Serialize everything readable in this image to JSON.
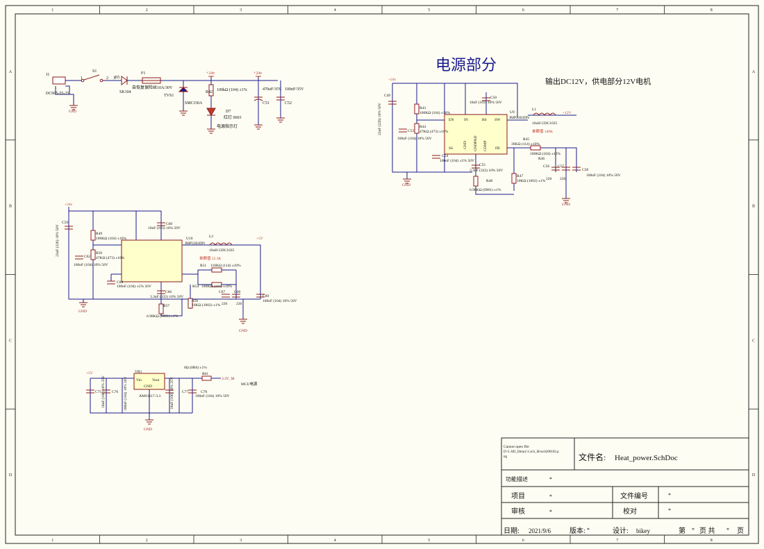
{
  "sheet": {
    "colors": {
      "bg": "#fdfdf3",
      "frame": "#222222",
      "wire": "#1a1a8c",
      "comp": "#8b1a1a",
      "power": "#c0392b",
      "gnd": "#8b1a1a",
      "ic_fill": "#ffffcc",
      "grid": "#e8e2c8"
    },
    "col_labels": [
      "1",
      "2",
      "3",
      "4",
      "5",
      "6",
      "7",
      "8"
    ],
    "row_labels": [
      "A",
      "B",
      "C",
      "D"
    ]
  },
  "texts": {
    "title_cn": "电源部分",
    "subtitle_cn": "输出DC12V，供电部分12V电机"
  },
  "input_section": {
    "j1": "J1",
    "j1_part": "DC005-55-25",
    "s1": "S1",
    "pin1": "1",
    "pin2": "2",
    "pin3": "3",
    "d5": "D5",
    "d5_part": "SK104",
    "f1": "F1",
    "f1_part": "自恢复保险丝10A/30V",
    "tvs_part": "SMCJ30A",
    "tvs_ref": "TVS1",
    "net_24v_a": "+24v",
    "net_24v_b": "+24v",
    "r42": "R42",
    "r42_val": "100kΩ (104) ±1%",
    "d7": "D7",
    "d7_val": "红灯 0603",
    "d7_note": "电源指示灯",
    "c51": "C51",
    "c51_val": "470uF/35V",
    "c52": "C52",
    "c52_val": "100nF/35V"
  },
  "buck12": {
    "net_24v": "+24v",
    "c49": "C49",
    "c49_val": "22uF (226) 10% 50V",
    "r43": "R43",
    "r43_val": "100KΩ (104) ±10%",
    "r44": "R44",
    "r44_val": "47KΩ (473) ±10%",
    "c53": "C53",
    "c53_val": "100nF (104) 10% 50V",
    "c54": "C54",
    "c54_val": "100nF (104) ±5% 50V",
    "c50": "C50",
    "c50_val": "10nF (103) 10% 50V",
    "u9": "U9",
    "u9_part": "JMP2303DN",
    "pin_en": "EN",
    "pin_in": "IN",
    "pin_bs": "BS",
    "pin_sw": "SW",
    "pin_ss": "SS",
    "pin_gnd": "GND",
    "pin_gndpad": "GNDPAD",
    "pin_comp": "COMP",
    "pin_fb": "FB",
    "l1": "L1",
    "l1_val": "10uH GDC1035",
    "net_12v": "+12V",
    "note_res": "单颗值 140K",
    "r45": "R45",
    "r45_val": "39KΩ (114) ±10%",
    "r46": "R46",
    "r46_val": "100KΩ (104) ±10%",
    "c55": "C55",
    "c55_val": "3.3nF (332) 10% 50V",
    "r48": "R48",
    "r48_val": "6.98KΩ (6981) ±1%",
    "r47": "R47",
    "r47_val": "10KΩ (1002) ±1%",
    "c56": "C56",
    "c56_val": "226",
    "c57": "C57",
    "c57_val": "226",
    "c58": "C58",
    "c58_val": "100nF (104) 10% 50V",
    "gnd1": "GND",
    "gnd2": "GND"
  },
  "buck5": {
    "net_24v": "+24v",
    "c59": "C59",
    "c59_val": "22uF (226) 10% 50V",
    "r49": "R49",
    "r49_val": "100KΩ (104) ±10%",
    "r50": "R50",
    "r50_val": "47KΩ (473) ±10%",
    "c62": "C62",
    "c62_val": "100nF (104) 10% 50V",
    "c64": "C64",
    "c64_val": "100nF (104) ±5% 50V",
    "c60": "C60",
    "c60_val": "10nF (103) 10% 50V",
    "u10": "U10",
    "u10_part": "JMP2303DN",
    "l2": "L2",
    "l2_val": "10uH GDC1035",
    "net_5v": "+5V",
    "note_res": "单颗值 52.3K",
    "r51": "R51",
    "r51_val": "110KΩ (114) ±10%",
    "r54": "R54",
    "r54_val": "100KΩ (104) ±10%",
    "c66": "C66",
    "c66_val": "3.3nF (332) 10% 50V",
    "r57": "R57",
    "r57_val": "6.98KΩ (6981) ±1%",
    "r56": "R56",
    "r56_val": "10KΩ (1002) ±1%",
    "c67": "C67",
    "c67_val": "226",
    "c68": "C68",
    "c68_val": "226",
    "c69": "C69",
    "c69_val": "100nF (104) 10% 50V",
    "gnd1": "GND",
    "gnd2": "GND"
  },
  "ldo": {
    "net_5v": "+5V",
    "c75": "C75",
    "c75_val": "10uF (106) 10% 25V",
    "c76": "C76",
    "c76_val": "100nF (104) 10% 50V",
    "vr1": "VR1",
    "vin": "Vin",
    "vout": "Vout",
    "gnd_pin": "GND",
    "part": "AMS1117-3.3",
    "c77": "C77",
    "c77_val": "10uF (106) 10% 25V",
    "c78": "C78",
    "c78_val": "100nF (104) 10% 50V",
    "r61": "R61",
    "r61_val": "0Ω (0R0) ±1%",
    "net_33": "3.3V_M",
    "mcu": "MCU电源",
    "gnd": "GND"
  },
  "title_block": {
    "cannot_open": "Cannot open file",
    "path_line1": "D:\\1.AD_library\\1.sch_lib\\sch200102.p",
    "path_line2": "ng",
    "file_name_label": "文件名:",
    "file_name": "Heat_power.SchDoc",
    "func_label": "功能描述",
    "func_val": "*",
    "project_label": "项目",
    "project_val": "*",
    "file_no_label": "文件编号",
    "file_no_val": "*",
    "review_label": "审核",
    "review_val": "*",
    "check_label": "校对",
    "check_val": "*",
    "date_label": "日期:",
    "date_val": "2021/9/6",
    "version_label": "版本:",
    "version_val": "*",
    "design_label": "设计:",
    "design_val": "bikey",
    "page_label_1": "第",
    "page_val_1": "*",
    "page_label_2": "页 共",
    "page_val_2": "*",
    "page_label_3": "页"
  }
}
